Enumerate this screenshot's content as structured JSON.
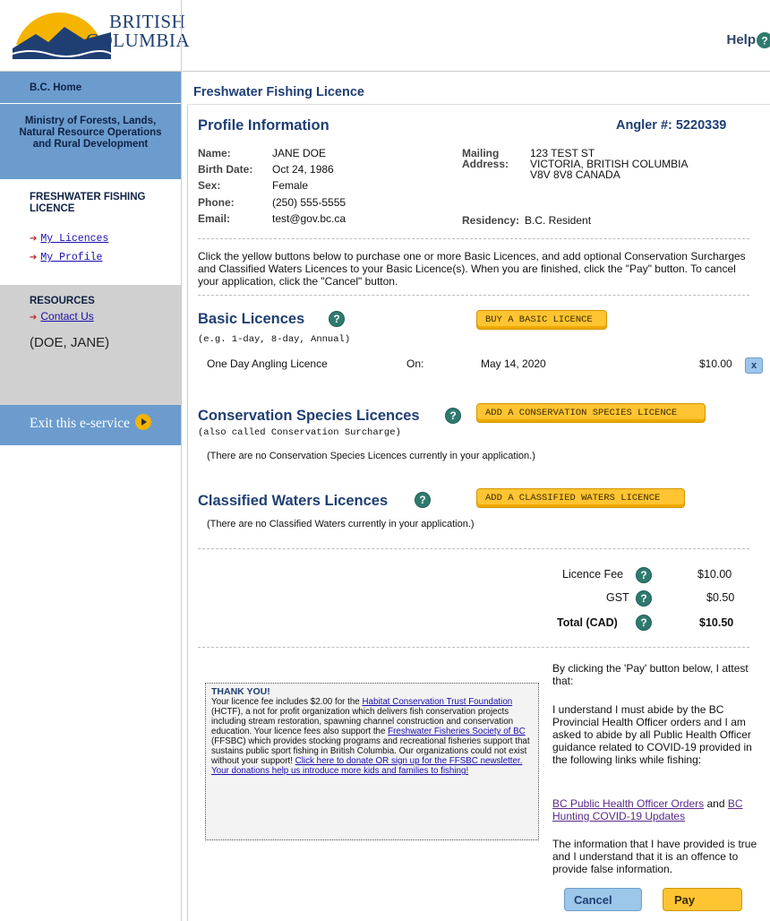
{
  "header": {
    "logo_line1": "BRITISH",
    "logo_line2": "COLUMBIA",
    "help_label": "Help"
  },
  "sidebar": {
    "home": "B.C. Home",
    "ministry": "Ministry of Forests, Lands, Natural Resource Operations and Rural Development",
    "service_title": "FRESHWATER FISHING LICENCE",
    "links": [
      "My Licences",
      "My Profile"
    ],
    "resources_title": "RESOURCES",
    "contact": "Contact Us",
    "user": "(DOE, JANE)",
    "exit": "Exit this e-service"
  },
  "page": {
    "title": "Freshwater Fishing Licence"
  },
  "profile": {
    "heading": "Profile Information",
    "angler": "Angler #: 5220339",
    "name_label": "Name:",
    "name": "JANE DOE",
    "birth_label": "Birth Date:",
    "birth": "Oct 24, 1986",
    "sex_label": "Sex:",
    "sex": "Female",
    "phone_label": "Phone:",
    "phone": "(250) 555-5555",
    "email_label": "Email:",
    "email": "test@gov.bc.ca",
    "mailing_label1": "Mailing",
    "mailing_label2": "Address:",
    "address1": "123 TEST ST",
    "address2": "VICTORIA, BRITISH COLUMBIA",
    "address3": "V8V 8V8 CANADA",
    "residency_label": "Residency:",
    "residency": "B.C. Resident"
  },
  "instructions": "Click the yellow buttons below to purchase one or more Basic Licences, and add optional Conservation Surcharges and Classified Waters Licences to your Basic Licence(s). When you are finished, click the \"Pay\" button. To cancel your application, click the \"Cancel\" button.",
  "basic": {
    "heading": "Basic Licences",
    "button": "BUY A BASIC LICENCE",
    "sub": "(e.g. 1-day, 8-day, Annual)",
    "item_name": "One Day Angling Licence",
    "item_on": "On:",
    "item_date": "May 14, 2020",
    "item_price": "$10.00",
    "remove": "x"
  },
  "conservation": {
    "heading": "Conservation Species Licences",
    "button": "ADD A CONSERVATION SPECIES LICENCE",
    "sub": "(also called Conservation Surcharge)",
    "empty": "(There are no Conservation Species Licences currently in your application.)"
  },
  "classified": {
    "heading": "Classified Waters Licences",
    "button": "ADD A CLASSIFIED WATERS LICENCE",
    "empty": "(There are no Classified Waters currently in your application.)"
  },
  "totals": {
    "fee_label": "Licence Fee",
    "fee": "$10.00",
    "gst_label": "GST",
    "gst": "$0.50",
    "total_label": "Total (CAD)",
    "total": "$10.50"
  },
  "thankyou": {
    "heading": "THANK YOU!",
    "t1": "Your licence fee includes $2.00 for the ",
    "link1": "Habitat Conservation Trust Foundation",
    "t2": " (HCTF), a not for profit organization which delivers fish conservation projects including stream restoration, spawning channel construction and conservation education. Your licence fees also support the ",
    "link2": "Freshwater Fisheries Society of BC",
    "t3": " (FFSBC) which provides stocking programs and recreational fisheries support that sustains public sport fishing in British Columbia. Our organizations could not exist without your support! ",
    "link3": "Click here to donate OR sign up for the FFSBC newsletter. Your donations help us introduce more kids and families to fishing!"
  },
  "attest": {
    "p1": "By clicking the 'Pay' button below, I attest that:",
    "p2": "I understand I must abide by the BC Provincial Health Officer orders and I am asked to abide by all Public Health Officer guidance related to COVID-19 provided in the following links while fishing:",
    "link1": "BC Public Health Officer Orders",
    "and": " and ",
    "link2": "BC Hunting COVID-19 Updates",
    "p3": "The information that I have provided is true and I understand that it is an offence to provide false information."
  },
  "actions": {
    "cancel": "Cancel",
    "pay": "Pay"
  },
  "colors": {
    "heading_blue": "#1f3f73",
    "sidebar_blue": "#6c9cce",
    "yellow_button": "#ffc431",
    "help_green": "#2f7a6f"
  }
}
